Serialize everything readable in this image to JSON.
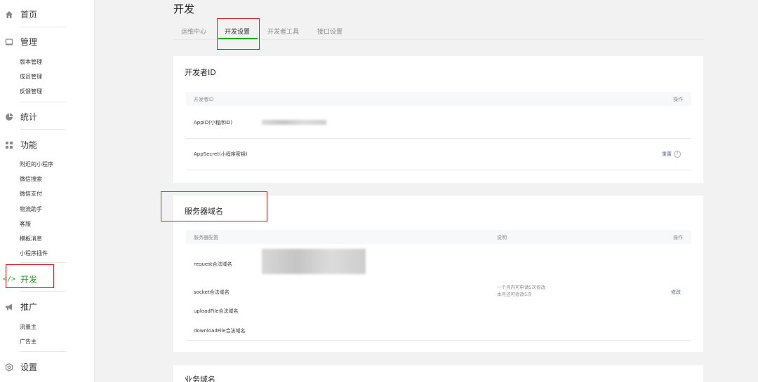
{
  "sidebar": {
    "home": "首页",
    "manage": "管理",
    "manage_items": [
      "版本管理",
      "成员管理",
      "反馈管理"
    ],
    "stats": "统计",
    "features": "功能",
    "feature_items": [
      "附近的小程序",
      "微信搜索",
      "微信支付",
      "物流助手",
      "客服",
      "模板消息",
      "小程序插件"
    ],
    "dev": "开发",
    "promo": "推广",
    "promo_items": [
      "流量主",
      "广告主"
    ],
    "settings": "设置"
  },
  "page": {
    "title": "开发"
  },
  "tabs": [
    "运维中心",
    "开发设置",
    "开发者工具",
    "接口设置"
  ],
  "dev_id": {
    "title": "开发者ID",
    "col_id": "开发者ID",
    "col_action": "操作",
    "appid_label": "AppID(小程序ID)",
    "appsecret_label": "AppSecret(小程序密钥)",
    "reset": "重置"
  },
  "server": {
    "title": "服务器域名",
    "col_config": "服务器配置",
    "col_desc": "说明",
    "col_action": "操作",
    "rows": [
      "request合法域名",
      "socket合法域名",
      "uploadFile合法域名",
      "downloadFile合法域名"
    ],
    "note1": "一个月内可申请5次修改",
    "note2": "本月还可修改5次",
    "modify": "修改"
  },
  "business": {
    "title": "业务域名"
  },
  "colors": {
    "accent": "#1aad19",
    "link": "#576b95",
    "highlight": "#e02020"
  }
}
